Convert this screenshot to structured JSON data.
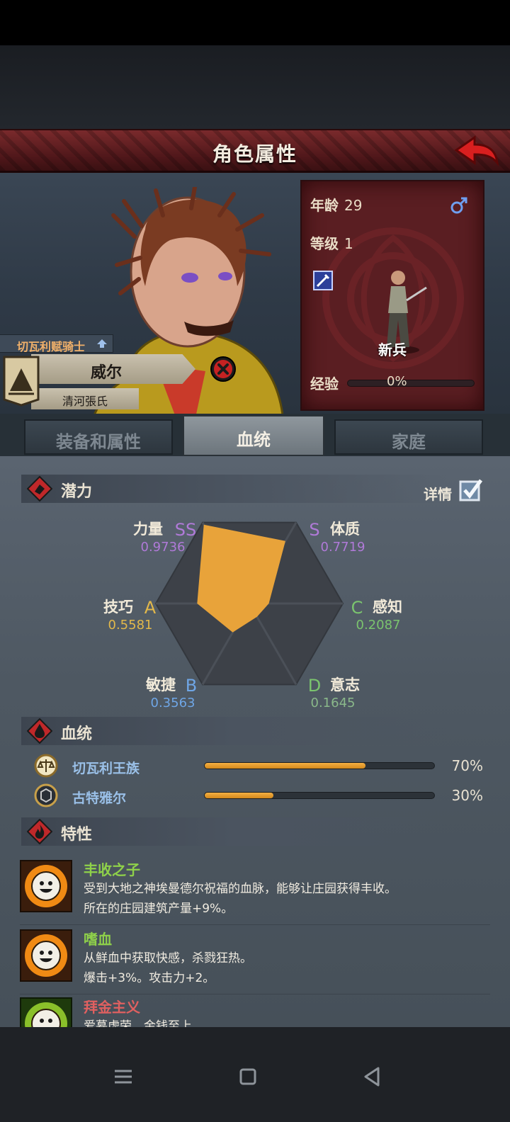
{
  "header": {
    "title": "角色属性"
  },
  "hero": {
    "rank": "切瓦利赋骑士",
    "name": "威尔",
    "house": "清河張氏"
  },
  "info": {
    "age_label": "年龄",
    "age_value": "29",
    "level_label": "等级",
    "level_value": "1",
    "class_name": "新兵",
    "exp_label": "经验",
    "exp_value": "0%",
    "exp_fraction": 0,
    "gender_icon": "male-icon"
  },
  "tabs": [
    {
      "label": "装备和属性",
      "active": false
    },
    {
      "label": "血统",
      "active": true
    },
    {
      "label": "家庭",
      "active": false
    }
  ],
  "potential": {
    "title": "潜力",
    "detail_label": "详情",
    "detail_checked": true,
    "stats": [
      {
        "name": "力量",
        "grade": "SS",
        "value": "0.9736",
        "grade_color": "#b07ad8",
        "value_color": "#b07ad8",
        "v": 0.9736
      },
      {
        "name": "体质",
        "grade": "S",
        "value": "0.7719",
        "grade_color": "#b07ad8",
        "value_color": "#b07ad8",
        "v": 0.7719
      },
      {
        "name": "感知",
        "grade": "C",
        "value": "0.2087",
        "grade_color": "#7bc46e",
        "value_color": "#7bc46e",
        "v": 0.2087
      },
      {
        "name": "意志",
        "grade": "D",
        "value": "0.1645",
        "grade_color": "#7bc46e",
        "value_color": "#8ab88a",
        "v": 0.1645
      },
      {
        "name": "敏捷",
        "grade": "B",
        "value": "0.3563",
        "grade_color": "#6fa6e6",
        "value_color": "#6fa6e6",
        "v": 0.3563
      },
      {
        "name": "技巧",
        "grade": "A",
        "value": "0.5581",
        "grade_color": "#e2b84a",
        "value_color": "#e2b84a",
        "v": 0.5581
      }
    ],
    "fill_color": "#e8a33a"
  },
  "bloodline": {
    "title": "血统",
    "items": [
      {
        "name": "切瓦利王族",
        "pct": "70%",
        "fraction": 0.7
      },
      {
        "name": "古特雅尔",
        "pct": "30%",
        "fraction": 0.3
      }
    ]
  },
  "traits": {
    "title": "特性",
    "items": [
      {
        "name": "丰收之子",
        "name_color": "#8fd14a",
        "lines": [
          "受到大地之神埃曼德尔祝福的血脉，能够让庄园获得丰收。",
          "所在的庄园建筑产量+9%。"
        ]
      },
      {
        "name": "嗜血",
        "name_color": "#8fd14a",
        "lines": [
          "从鲜血中获取快感，杀戮狂热。",
          "爆击+3%。攻击力+2。"
        ]
      },
      {
        "name": "拜金主义",
        "name_color": "#e06060",
        "lines": [
          "爱慕虚荣，金钱至上。",
          ""
        ]
      }
    ]
  }
}
